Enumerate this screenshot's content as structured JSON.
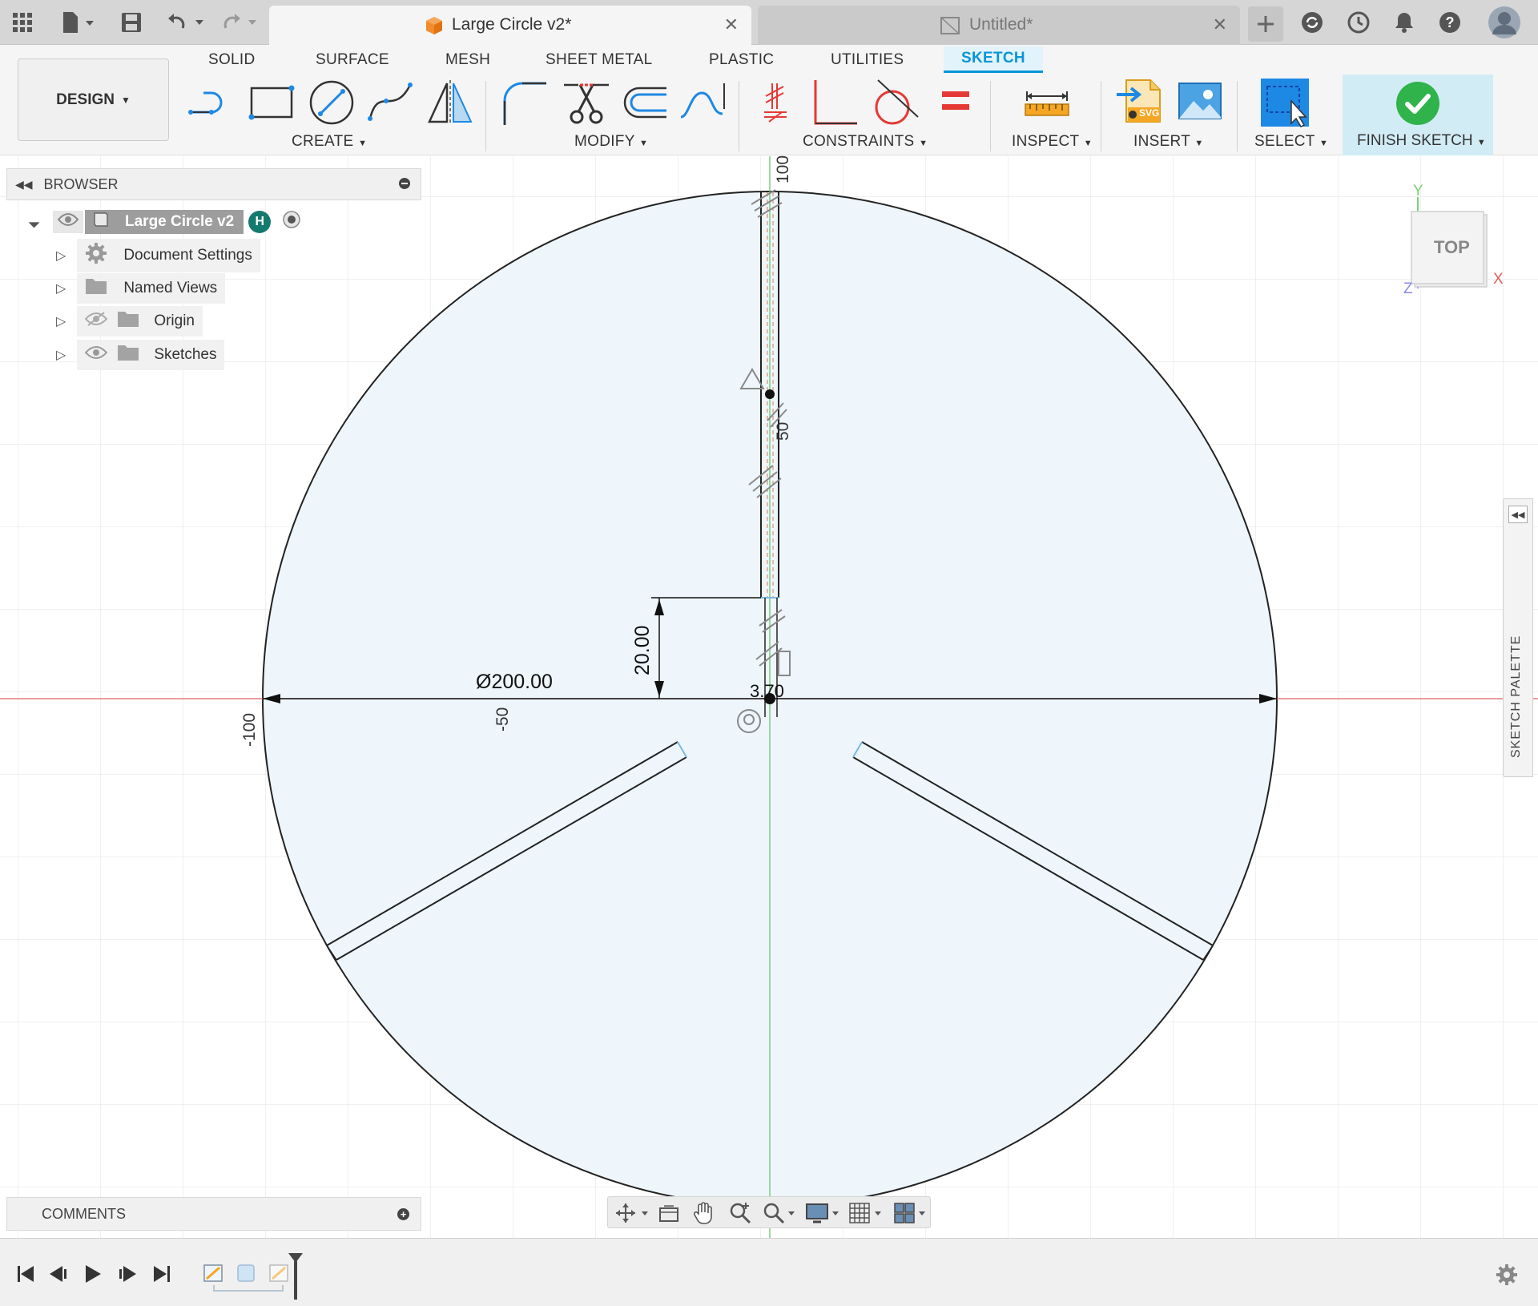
{
  "tabs": {
    "active": {
      "title": "Large Circle v2*"
    },
    "inactive": {
      "title": "Untitled*"
    }
  },
  "workspace_tabs": [
    "SOLID",
    "SURFACE",
    "MESH",
    "SHEET METAL",
    "PLASTIC",
    "UTILITIES",
    "SKETCH"
  ],
  "active_workspace_tab": "SKETCH",
  "toolbar": {
    "design_label": "DESIGN",
    "groups": {
      "create": "CREATE",
      "modify": "MODIFY",
      "constraints": "CONSTRAINTS",
      "inspect": "INSPECT",
      "insert": "INSERT",
      "select": "SELECT",
      "finish": "FINISH SKETCH"
    },
    "svg_badge": "SVG"
  },
  "browser": {
    "title": "BROWSER",
    "root": "Large Circle v2",
    "root_badge": "H",
    "items": [
      "Document Settings",
      "Named Views",
      "Origin",
      "Sketches"
    ]
  },
  "comments": {
    "title": "COMMENTS"
  },
  "viewcube": {
    "face": "TOP",
    "axis_x": "X",
    "axis_y": "Y",
    "axis_z": "Z"
  },
  "sketch_palette": {
    "label": "SKETCH PALETTE"
  },
  "canvas": {
    "dimension_diameter": "Ø200.00",
    "dimension_height": "20.00",
    "dimension_small": "3.70",
    "ruler_labels": {
      "x_neg100": "-100",
      "x_neg50": "-50",
      "y_100": "100",
      "y_50": "50"
    }
  },
  "colors": {
    "accent": "#0696d7",
    "sketch_fill": "#eef6fc",
    "finish_green": "#2fb34a",
    "axis_red": "#e06060",
    "axis_green": "#60c060",
    "select_blue": "#1e88e5"
  }
}
